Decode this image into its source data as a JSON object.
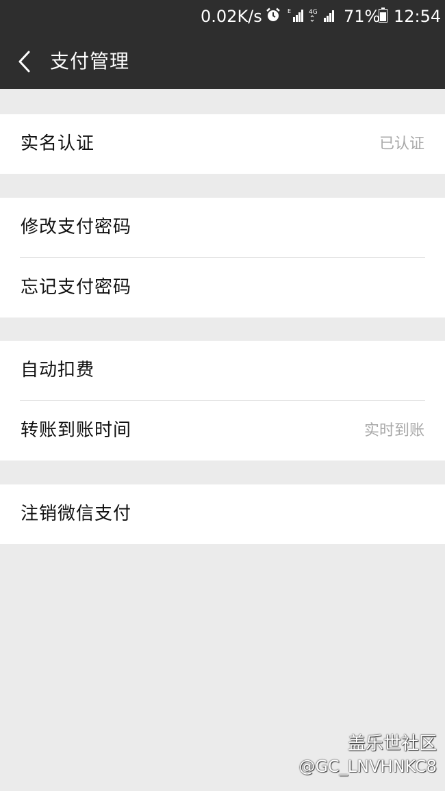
{
  "status_bar": {
    "net_speed": "0.02K/s",
    "battery_percent": "71%",
    "time": "12:54",
    "icons": [
      "alarm-icon",
      "sim1-signal-icon",
      "lte-signal-icon",
      "battery-icon"
    ]
  },
  "header": {
    "back_icon": "chevron-left-icon",
    "title": "支付管理"
  },
  "groups": [
    {
      "items": [
        {
          "label": "实名认证",
          "value": "已认证"
        }
      ]
    },
    {
      "items": [
        {
          "label": "修改支付密码"
        },
        {
          "label": "忘记支付密码"
        }
      ]
    },
    {
      "items": [
        {
          "label": "自动扣费"
        },
        {
          "label": "转账到账时间",
          "value": "实时到账"
        }
      ]
    },
    {
      "items": [
        {
          "label": "注销微信支付"
        }
      ]
    }
  ],
  "watermark": {
    "site": "盖乐世社区",
    "user": "@GC_LNVHNKC8"
  },
  "colors": {
    "header_bg": "#2e2e2e",
    "page_bg": "#ebebeb",
    "row_bg": "#ffffff",
    "value_text": "#a8a8a8"
  }
}
